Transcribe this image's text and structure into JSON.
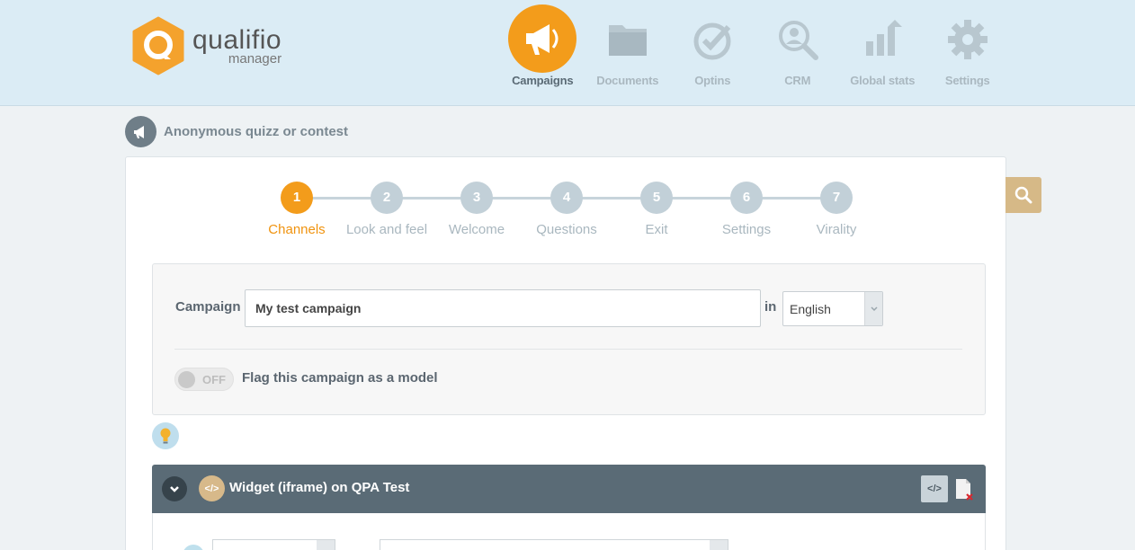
{
  "logo": {
    "name": "qualifio",
    "sub": "manager"
  },
  "nav": {
    "items": [
      {
        "label": "Campaigns",
        "icon": "megaphone-icon",
        "active": true
      },
      {
        "label": "Documents",
        "icon": "folder-icon"
      },
      {
        "label": "Optins",
        "icon": "checkmark-circle-icon"
      },
      {
        "label": "CRM",
        "icon": "user-search-icon"
      },
      {
        "label": "Global stats",
        "icon": "bar-chart-icon"
      },
      {
        "label": "Settings",
        "icon": "gear-icon"
      }
    ]
  },
  "breadcrumb": {
    "title": "Anonymous quizz or contest"
  },
  "stepper": {
    "steps": [
      {
        "num": "1",
        "label": "Channels"
      },
      {
        "num": "2",
        "label": "Look and feel"
      },
      {
        "num": "3",
        "label": "Welcome"
      },
      {
        "num": "4",
        "label": "Questions"
      },
      {
        "num": "5",
        "label": "Exit"
      },
      {
        "num": "6",
        "label": "Settings"
      },
      {
        "num": "7",
        "label": "Virality"
      }
    ],
    "active_index": 0
  },
  "form": {
    "campaign_label": "Campaign",
    "campaign_value": "My test campaign",
    "in_label": "in",
    "language_value": "English",
    "toggle_state": "OFF",
    "flag_label": "Flag this campaign as a model"
  },
  "widget": {
    "code_glyph": "</>",
    "title": "Widget (iframe) on QPA Test",
    "embed_glyph": "</>"
  },
  "colors": {
    "accent": "#f39c1b",
    "header_bg": "#dbecf5",
    "widget_bar": "#5a6b76",
    "gold": "#d6b987"
  }
}
